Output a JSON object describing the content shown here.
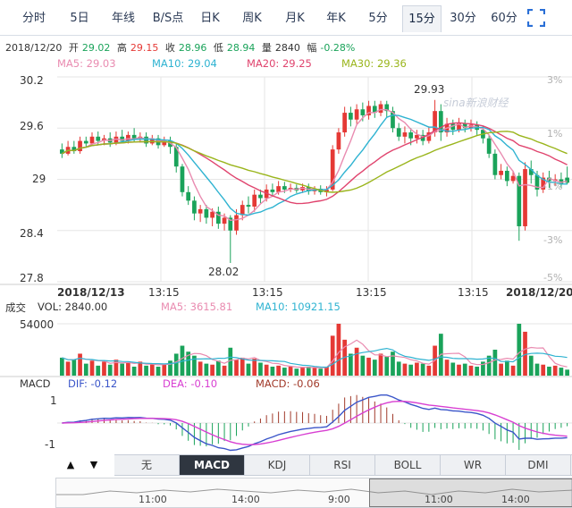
{
  "tabs": [
    {
      "label": "分时",
      "active": false
    },
    {
      "label": "5日",
      "active": false
    },
    {
      "label": "年线",
      "active": false
    },
    {
      "label": "B/S点",
      "active": false
    },
    {
      "label": "日K",
      "active": false
    },
    {
      "label": "周K",
      "active": false
    },
    {
      "label": "月K",
      "active": false
    },
    {
      "label": "年K",
      "active": false
    },
    {
      "label": "5分",
      "active": false
    },
    {
      "label": "15分",
      "active": true
    },
    {
      "label": "30分",
      "active": false
    },
    {
      "label": "60分",
      "active": false
    }
  ],
  "fullscreen_icon": "fullscreen-icon",
  "info": {
    "date": "2018/12/20",
    "open_label": "开",
    "open": "29.02",
    "high_label": "高",
    "high": "29.15",
    "close_label": "收",
    "close": "28.96",
    "low_label": "低",
    "low": "28.94",
    "vol_label": "量",
    "vol": "2840",
    "chg_label": "幅",
    "chg": "-0.28%"
  },
  "ma": [
    {
      "text": "MA5: 29.03",
      "color": "#e98bb0"
    },
    {
      "text": "MA10: 29.04",
      "color": "#2fb3d1"
    },
    {
      "text": "MA20: 29.25",
      "color": "#e0446e"
    },
    {
      "text": "MA30: 29.36",
      "color": "#9ab51c"
    }
  ],
  "watermark": "sina新浪财经",
  "price_axis": [
    "30.2",
    "29.6",
    "29",
    "28.4",
    "27.8"
  ],
  "pct_axis": [
    "3%",
    "1%",
    "-1%",
    "-3%",
    "-5%"
  ],
  "time_axis": [
    "2018/12/13",
    "13:15",
    "13:15",
    "13:15",
    "13:15",
    "2018/12/20"
  ],
  "volume": {
    "label": "成交",
    "vol_text": "VOL: 2840.00",
    "ma5_text": "MA5: 3615.81",
    "ma10_text": "MA10: 10921.15",
    "axis_top": "54000",
    "ma5_color": "#e98bb0",
    "ma10_color": "#2fb3d1"
  },
  "macd": {
    "label": "MACD",
    "dif_text": "DIF: -0.12",
    "dea_text": "DEA: -0.10",
    "macd_text": "MACD: -0.06",
    "axis": [
      "1",
      "-1"
    ],
    "dif_color": "#3a55c9",
    "dea_color": "#d83fd2",
    "macd_color": "#a13a2a"
  },
  "indicator_tabs": [
    {
      "label": "无",
      "active": false
    },
    {
      "label": "MACD",
      "active": true
    },
    {
      "label": "KDJ",
      "active": false
    },
    {
      "label": "RSI",
      "active": false
    },
    {
      "label": "BOLL",
      "active": false
    },
    {
      "label": "WR",
      "active": false
    },
    {
      "label": "DMI",
      "active": false
    }
  ],
  "nav_buttons": {
    "up": "▲",
    "down": "▼"
  },
  "navigator_labels": [
    "11:00",
    "14:00",
    "9:00",
    "11:00",
    "14:00"
  ],
  "colors": {
    "up": "#e53935",
    "down": "#1aa35a",
    "grid": "#e6e6e6"
  },
  "chart_data": {
    "type": "candlestick",
    "title": "",
    "ylim": [
      27.8,
      30.2
    ],
    "price_annotations": [
      {
        "text": "29.93",
        "value": 29.93
      },
      {
        "text": "28.02",
        "value": 28.02
      }
    ],
    "candles": [
      {
        "o": 29.35,
        "c": 29.3,
        "h": 29.42,
        "l": 29.25
      },
      {
        "o": 29.3,
        "c": 29.38,
        "h": 29.45,
        "l": 29.28
      },
      {
        "o": 29.38,
        "c": 29.33,
        "h": 29.45,
        "l": 29.3
      },
      {
        "o": 29.33,
        "c": 29.45,
        "h": 29.5,
        "l": 29.3
      },
      {
        "o": 29.45,
        "c": 29.42,
        "h": 29.5,
        "l": 29.38
      },
      {
        "o": 29.42,
        "c": 29.5,
        "h": 29.55,
        "l": 29.4
      },
      {
        "o": 29.5,
        "c": 29.45,
        "h": 29.56,
        "l": 29.4
      },
      {
        "o": 29.45,
        "c": 29.48,
        "h": 29.52,
        "l": 29.4
      },
      {
        "o": 29.48,
        "c": 29.43,
        "h": 29.55,
        "l": 29.38
      },
      {
        "o": 29.43,
        "c": 29.5,
        "h": 29.56,
        "l": 29.4
      },
      {
        "o": 29.5,
        "c": 29.45,
        "h": 29.58,
        "l": 29.42
      },
      {
        "o": 29.45,
        "c": 29.52,
        "h": 29.56,
        "l": 29.42
      },
      {
        "o": 29.52,
        "c": 29.47,
        "h": 29.6,
        "l": 29.44
      },
      {
        "o": 29.47,
        "c": 29.5,
        "h": 29.55,
        "l": 29.43
      },
      {
        "o": 29.5,
        "c": 29.42,
        "h": 29.55,
        "l": 29.38
      },
      {
        "o": 29.42,
        "c": 29.48,
        "h": 29.52,
        "l": 29.4
      },
      {
        "o": 29.48,
        "c": 29.4,
        "h": 29.52,
        "l": 29.36
      },
      {
        "o": 29.4,
        "c": 29.45,
        "h": 29.5,
        "l": 29.38
      },
      {
        "o": 29.45,
        "c": 29.38,
        "h": 29.5,
        "l": 29.3
      },
      {
        "o": 29.38,
        "c": 29.15,
        "h": 29.42,
        "l": 29.08
      },
      {
        "o": 29.15,
        "c": 28.85,
        "h": 29.18,
        "l": 28.8
      },
      {
        "o": 28.85,
        "c": 28.75,
        "h": 28.92,
        "l": 28.7
      },
      {
        "o": 28.75,
        "c": 28.6,
        "h": 28.8,
        "l": 28.52
      },
      {
        "o": 28.6,
        "c": 28.65,
        "h": 28.7,
        "l": 28.5
      },
      {
        "o": 28.65,
        "c": 28.55,
        "h": 28.7,
        "l": 28.48
      },
      {
        "o": 28.55,
        "c": 28.62,
        "h": 28.66,
        "l": 28.45
      },
      {
        "o": 28.62,
        "c": 28.48,
        "h": 28.68,
        "l": 28.42
      },
      {
        "o": 28.48,
        "c": 28.55,
        "h": 28.6,
        "l": 28.4
      },
      {
        "o": 28.55,
        "c": 28.4,
        "h": 28.58,
        "l": 28.02
      },
      {
        "o": 28.4,
        "c": 28.58,
        "h": 28.65,
        "l": 28.35
      },
      {
        "o": 28.58,
        "c": 28.7,
        "h": 28.75,
        "l": 28.52
      },
      {
        "o": 28.7,
        "c": 28.68,
        "h": 28.8,
        "l": 28.6
      },
      {
        "o": 28.68,
        "c": 28.82,
        "h": 28.88,
        "l": 28.62
      },
      {
        "o": 28.82,
        "c": 28.78,
        "h": 28.88,
        "l": 28.72
      },
      {
        "o": 28.78,
        "c": 28.88,
        "h": 28.94,
        "l": 28.74
      },
      {
        "o": 28.88,
        "c": 28.85,
        "h": 28.95,
        "l": 28.8
      },
      {
        "o": 28.85,
        "c": 28.92,
        "h": 28.98,
        "l": 28.82
      },
      {
        "o": 28.92,
        "c": 28.88,
        "h": 28.97,
        "l": 28.84
      },
      {
        "o": 28.88,
        "c": 28.9,
        "h": 28.95,
        "l": 28.85
      },
      {
        "o": 28.9,
        "c": 28.87,
        "h": 28.94,
        "l": 28.84
      },
      {
        "o": 28.87,
        "c": 28.91,
        "h": 28.95,
        "l": 28.84
      },
      {
        "o": 28.91,
        "c": 28.86,
        "h": 28.95,
        "l": 28.82
      },
      {
        "o": 28.86,
        "c": 28.89,
        "h": 28.92,
        "l": 28.82
      },
      {
        "o": 28.89,
        "c": 28.85,
        "h": 28.93,
        "l": 28.82
      },
      {
        "o": 28.85,
        "c": 28.88,
        "h": 28.92,
        "l": 28.8
      },
      {
        "o": 28.88,
        "c": 29.35,
        "h": 29.4,
        "l": 28.86
      },
      {
        "o": 29.35,
        "c": 29.55,
        "h": 29.6,
        "l": 29.3
      },
      {
        "o": 29.55,
        "c": 29.78,
        "h": 29.85,
        "l": 29.5
      },
      {
        "o": 29.78,
        "c": 29.7,
        "h": 29.85,
        "l": 29.62
      },
      {
        "o": 29.7,
        "c": 29.82,
        "h": 29.88,
        "l": 29.65
      },
      {
        "o": 29.82,
        "c": 29.75,
        "h": 29.9,
        "l": 29.68
      },
      {
        "o": 29.75,
        "c": 29.86,
        "h": 29.92,
        "l": 29.7
      },
      {
        "o": 29.86,
        "c": 29.78,
        "h": 29.92,
        "l": 29.72
      },
      {
        "o": 29.78,
        "c": 29.88,
        "h": 29.92,
        "l": 29.74
      },
      {
        "o": 29.88,
        "c": 29.8,
        "h": 29.92,
        "l": 29.72
      },
      {
        "o": 29.8,
        "c": 29.6,
        "h": 29.85,
        "l": 29.55
      },
      {
        "o": 29.6,
        "c": 29.5,
        "h": 29.66,
        "l": 29.45
      },
      {
        "o": 29.5,
        "c": 29.55,
        "h": 29.62,
        "l": 29.42
      },
      {
        "o": 29.55,
        "c": 29.48,
        "h": 29.6,
        "l": 29.4
      },
      {
        "o": 29.48,
        "c": 29.52,
        "h": 29.58,
        "l": 29.42
      },
      {
        "o": 29.52,
        "c": 29.45,
        "h": 29.58,
        "l": 29.4
      },
      {
        "o": 29.45,
        "c": 29.55,
        "h": 29.62,
        "l": 29.42
      },
      {
        "o": 29.55,
        "c": 29.8,
        "h": 29.93,
        "l": 29.5
      },
      {
        "o": 29.8,
        "c": 29.55,
        "h": 29.88,
        "l": 29.45
      },
      {
        "o": 29.55,
        "c": 29.65,
        "h": 29.72,
        "l": 29.5
      },
      {
        "o": 29.65,
        "c": 29.58,
        "h": 29.7,
        "l": 29.52
      },
      {
        "o": 29.58,
        "c": 29.66,
        "h": 29.72,
        "l": 29.55
      },
      {
        "o": 29.66,
        "c": 29.6,
        "h": 29.7,
        "l": 29.55
      },
      {
        "o": 29.6,
        "c": 29.64,
        "h": 29.7,
        "l": 29.56
      },
      {
        "o": 29.64,
        "c": 29.58,
        "h": 29.68,
        "l": 29.52
      },
      {
        "o": 29.58,
        "c": 29.48,
        "h": 29.62,
        "l": 29.42
      },
      {
        "o": 29.48,
        "c": 29.3,
        "h": 29.52,
        "l": 29.25
      },
      {
        "o": 29.3,
        "c": 29.05,
        "h": 29.35,
        "l": 29.0
      },
      {
        "o": 29.05,
        "c": 29.1,
        "h": 29.18,
        "l": 29.0
      },
      {
        "o": 29.1,
        "c": 28.98,
        "h": 29.15,
        "l": 28.92
      },
      {
        "o": 28.98,
        "c": 29.04,
        "h": 29.1,
        "l": 28.95
      },
      {
        "o": 29.04,
        "c": 28.45,
        "h": 29.08,
        "l": 28.28
      },
      {
        "o": 28.45,
        "c": 29.12,
        "h": 29.2,
        "l": 28.4
      },
      {
        "o": 29.12,
        "c": 29.05,
        "h": 29.22,
        "l": 28.95
      },
      {
        "o": 29.05,
        "c": 28.88,
        "h": 29.1,
        "l": 28.8
      },
      {
        "o": 28.88,
        "c": 29.02,
        "h": 29.08,
        "l": 28.84
      },
      {
        "o": 29.02,
        "c": 28.98,
        "h": 29.1,
        "l": 28.9
      },
      {
        "o": 28.98,
        "c": 29.0,
        "h": 29.06,
        "l": 28.92
      },
      {
        "o": 29.0,
        "c": 28.94,
        "h": 29.08,
        "l": 28.9
      },
      {
        "o": 29.02,
        "c": 28.96,
        "h": 29.15,
        "l": 28.94
      }
    ],
    "volumes": [
      18,
      14,
      16,
      22,
      12,
      15,
      10,
      14,
      11,
      16,
      12,
      13,
      9,
      14,
      10,
      12,
      9,
      11,
      15,
      22,
      30,
      24,
      20,
      14,
      12,
      11,
      15,
      10,
      28,
      16,
      18,
      12,
      17,
      13,
      11,
      9,
      10,
      8,
      9,
      7,
      8,
      9,
      8,
      7,
      9,
      40,
      52,
      36,
      22,
      28,
      20,
      18,
      16,
      22,
      19,
      24,
      14,
      12,
      11,
      13,
      12,
      10,
      30,
      42,
      16,
      13,
      11,
      12,
      10,
      9,
      14,
      20,
      26,
      12,
      15,
      10,
      52,
      44,
      20,
      12,
      11,
      9,
      10,
      8,
      6
    ]
  }
}
